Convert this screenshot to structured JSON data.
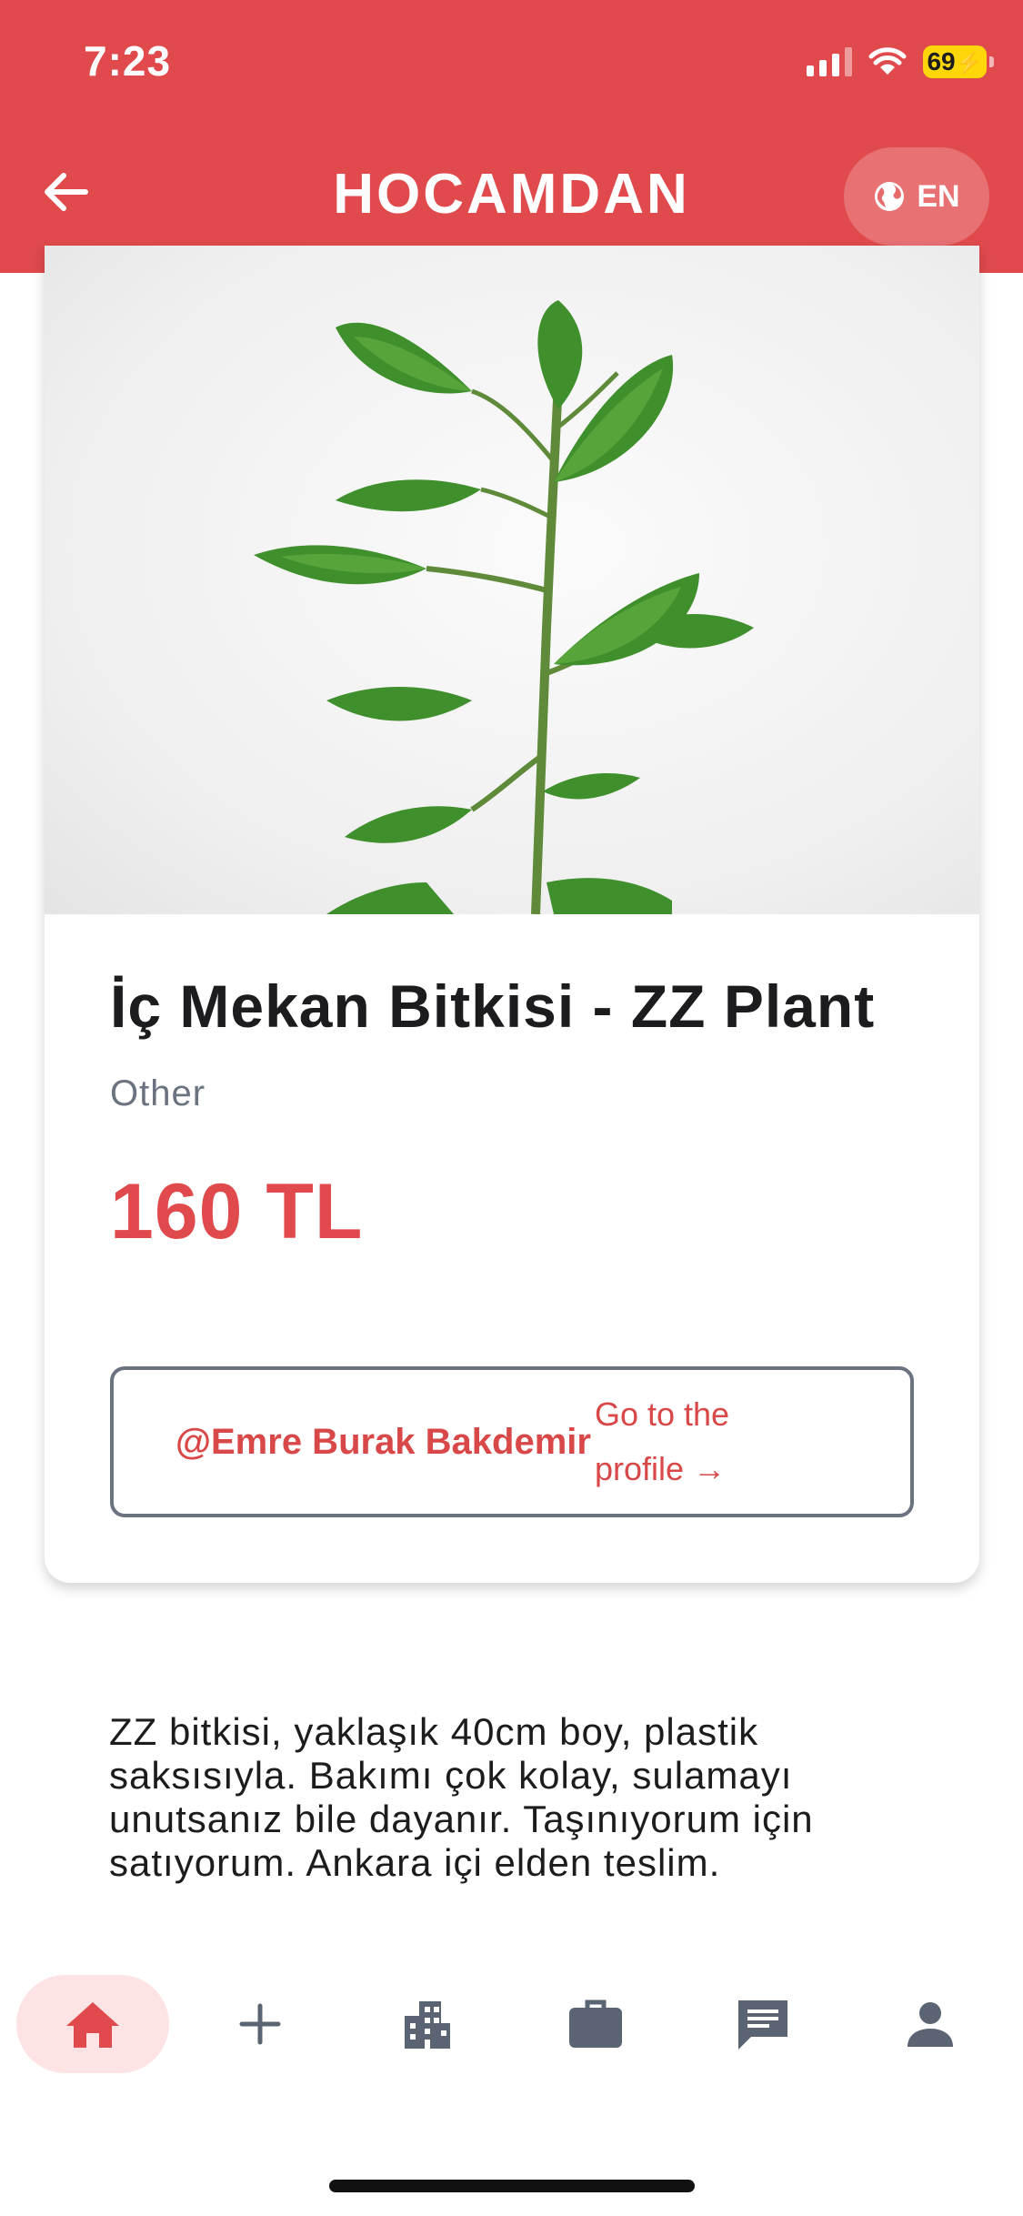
{
  "status_bar": {
    "time": "7:23",
    "battery": "69"
  },
  "header": {
    "back_icon": "arrow-left-icon",
    "title": "HOCAMDAN",
    "language_icon": "globe-icon",
    "language_label": "EN"
  },
  "product": {
    "image_subject": "potted plant photo",
    "title": "İç Mekan Bitkisi - ZZ Plant",
    "category": "Other",
    "price": "160 TL",
    "seller": "@Emre Burak Bakdemir",
    "profile_link": "Go to the profile →"
  },
  "description": "ZZ bitkisi, yaklaşık 40cm boy, plastik saksısıyla. Bakımı çok kolay, sulamayı unutsanız bile dayanır. Taşınıyorum için satıyorum. Ankara içi elden teslim.",
  "bottom_nav": {
    "items": [
      {
        "icon": "home-icon",
        "active": true
      },
      {
        "icon": "plus-icon",
        "active": false
      },
      {
        "icon": "building-icon",
        "active": false
      },
      {
        "icon": "briefcase-icon",
        "active": false
      },
      {
        "icon": "chat-icon",
        "active": false
      },
      {
        "icon": "person-icon",
        "active": false
      }
    ]
  },
  "colors": {
    "brand": "#e04a4c",
    "accent_text": "#d94848",
    "active_nav_bg": "#fde3e3",
    "muted": "#6b7280"
  }
}
